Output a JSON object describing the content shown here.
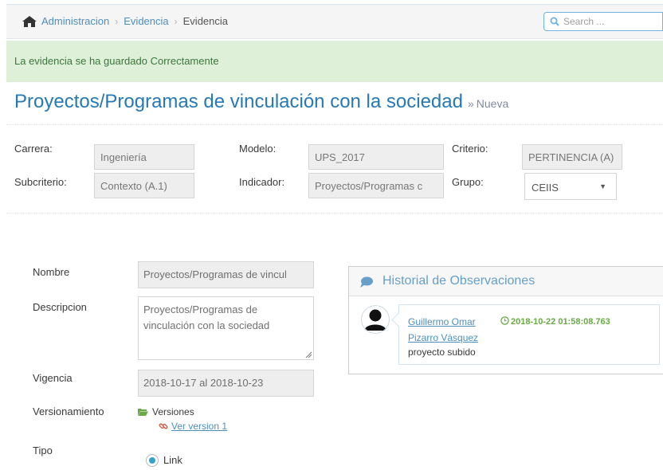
{
  "breadcrumb": {
    "items": [
      "Administracion",
      "Evidencia"
    ],
    "active": "Evidencia",
    "separator": "›"
  },
  "search": {
    "placeholder": "Search ..."
  },
  "alert": {
    "message": "La evidencia se ha guardado Correctamente"
  },
  "page": {
    "title": "Proyectos/Programas de vinculación con la sociedad",
    "subtitle_prefix": "»",
    "subtitle": "Nueva"
  },
  "filters": {
    "carrera_label": "Carrera:",
    "carrera_value": "Ingeniería",
    "modelo_label": "Modelo:",
    "modelo_value": "UPS_2017",
    "criterio_label": "Criterio:",
    "criterio_value": "PERTINENCIA (A)",
    "subcriterio_label": "Subcriterio:",
    "subcriterio_value": "Contexto (A.1)",
    "indicador_label": "Indicador:",
    "indicador_value": "Proyectos/Programas c",
    "grupo_label": "Grupo:",
    "grupo_value": "CEIIS"
  },
  "form": {
    "nombre_label": "Nombre",
    "nombre_value": "Proyectos/Programas de vincul",
    "descripcion_label": "Descripcion",
    "descripcion_value": "Proyectos/Programas de vinculación con la sociedad",
    "vigencia_label": "Vigencia",
    "vigencia_value": "2018-10-17 al 2018-10-23",
    "versionamiento_label": "Versionamiento",
    "versiones_label": "Versiones",
    "ver_version_label": "Ver version 1",
    "tipo_label": "Tipo",
    "tipo_option": "Link"
  },
  "history": {
    "title": "Historial de Observaciones",
    "comment": {
      "author": "Guillermo Omar Pizarro Vásquez",
      "timestamp": "2018-10-22 01:58:08.763",
      "text": "proyecto subido"
    }
  },
  "colors": {
    "link": "#4c8fbd",
    "title": "#2679b5",
    "alert_bg": "#dff0d8",
    "alert_text": "#3c763d",
    "timestamp": "#69aa46"
  },
  "icons": [
    "home-icon",
    "search-icon",
    "comment-icon",
    "clock-icon",
    "folder-open-icon",
    "link-icon",
    "user-avatar-icon"
  ]
}
